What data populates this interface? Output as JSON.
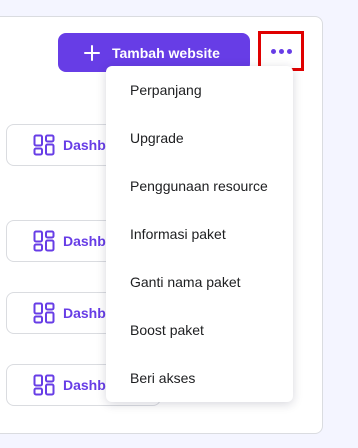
{
  "toolbar": {
    "add_website_label": "Tambah website",
    "more_icon": "more-horizontal-icon"
  },
  "websites": [
    {
      "dashboard_label": "Dashboard"
    },
    {
      "dashboard_label": "Dashboard"
    },
    {
      "dashboard_label": "Dashboard"
    },
    {
      "dashboard_label": "Dashboard"
    }
  ],
  "menu": {
    "items": [
      {
        "label": "Perpanjang"
      },
      {
        "label": "Upgrade"
      },
      {
        "label": "Penggunaan resource"
      },
      {
        "label": "Informasi paket"
      },
      {
        "label": "Ganti nama paket"
      },
      {
        "label": "Boost paket"
      },
      {
        "label": "Beri akses"
      }
    ]
  },
  "colors": {
    "primary": "#673de6",
    "highlight_border": "#e00000",
    "background": "#f4f5ff"
  }
}
